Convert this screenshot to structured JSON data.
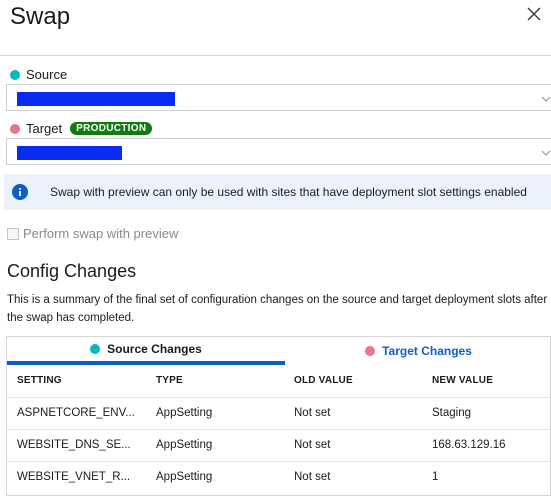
{
  "header": {
    "title": "Swap"
  },
  "source": {
    "label": "Source",
    "color": "#00b7c3"
  },
  "target": {
    "label": "Target",
    "badge": "PRODUCTION",
    "color": "#e8778b"
  },
  "info": {
    "message": "Swap with preview can only be used with sites that have deployment slot settings enabled"
  },
  "preview_checkbox": {
    "label": "Perform swap with preview",
    "checked": false,
    "disabled": true
  },
  "config": {
    "heading": "Config Changes",
    "summary": "This is a summary of the final set of configuration changes on the source and target deployment slots after the swap has completed."
  },
  "tabs": [
    {
      "label": "Source Changes",
      "selected": true
    },
    {
      "label": "Target Changes",
      "selected": false
    }
  ],
  "table": {
    "headers": [
      "SETTING",
      "TYPE",
      "OLD VALUE",
      "NEW VALUE"
    ],
    "rows": [
      [
        "ASPNETCORE_ENV...",
        "AppSetting",
        "Not set",
        "Staging"
      ],
      [
        "WEBSITE_DNS_SE...",
        "AppSetting",
        "Not set",
        "168.63.129.16"
      ],
      [
        "WEBSITE_VNET_R...",
        "AppSetting",
        "Not set",
        "1"
      ]
    ]
  }
}
